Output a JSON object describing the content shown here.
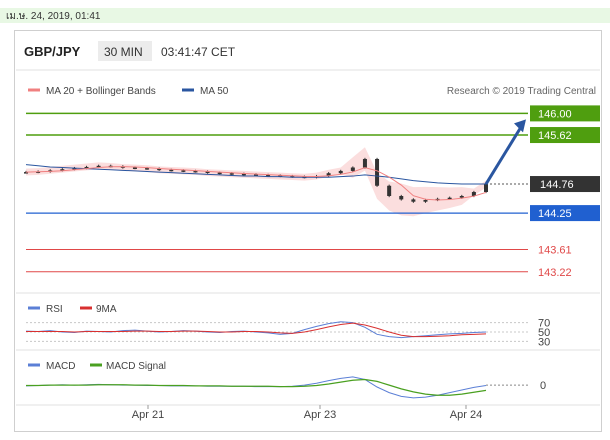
{
  "timestamp": "เม.ษ. 24, 2019, 01:41",
  "header": {
    "symbol": "GBP/JPY",
    "interval": "30 MIN",
    "time": "03:41:47 CET"
  },
  "legend": {
    "ma20": "MA 20 + Bollinger Bands",
    "ma50": "MA 50",
    "credit": "Research © 2019 Trading Central",
    "rsi": "RSI",
    "rsi_ma": "9MA",
    "macd": "MACD",
    "macd_signal": "MACD Signal"
  },
  "colors": {
    "ma20": "#f08080",
    "ma50": "#2a56a0",
    "resistance": "#4f9e0f",
    "support": "#2060d0",
    "support_red": "#e04848",
    "current": "#333333",
    "bollinger": "#fad6d6",
    "candle": "#333333",
    "rsi": "#5b7fd6",
    "rsi_ma": "#d83030",
    "macd": "#5b7fd6",
    "macd_signal": "#4aa020"
  },
  "chart_data": {
    "type": "line",
    "x_labels": [
      "Apr 21",
      "Apr 23",
      "Apr 24"
    ],
    "price_ylim": [
      142.9,
      146.2
    ],
    "price": [
      144.97,
      144.98,
      145.0,
      145.02,
      145.04,
      145.06,
      145.08,
      145.07,
      145.05,
      145.04,
      145.03,
      145.01,
      145.0,
      144.99,
      144.98,
      144.96,
      144.95,
      144.94,
      144.93,
      144.92,
      144.91,
      144.9,
      144.89,
      144.88,
      144.9,
      144.95,
      144.99,
      145.05,
      145.2,
      144.73,
      144.55,
      144.49,
      144.45,
      144.48,
      144.5,
      144.52,
      144.55,
      144.62,
      144.76
    ],
    "ma50": [
      145.1,
      145.08,
      145.06,
      145.05,
      145.04,
      145.03,
      145.02,
      145.01,
      145.0,
      144.99,
      144.98,
      144.97,
      144.96,
      144.95,
      144.94,
      144.93,
      144.92,
      144.91,
      144.9,
      144.9,
      144.89,
      144.89,
      144.88,
      144.88,
      144.88,
      144.88,
      144.89,
      144.9,
      144.92,
      144.9,
      144.88,
      144.85,
      144.82,
      144.8,
      144.78,
      144.77,
      144.76,
      144.76,
      144.76
    ],
    "levels": [
      {
        "value": 146.0,
        "label": "146.00",
        "kind": "resistance"
      },
      {
        "value": 145.62,
        "label": "145.62",
        "kind": "resistance"
      },
      {
        "value": 144.76,
        "label": "144.76",
        "kind": "current"
      },
      {
        "value": 144.25,
        "label": "144.25",
        "kind": "support"
      },
      {
        "value": 143.61,
        "label": "143.61",
        "kind": "support_red"
      },
      {
        "value": 143.22,
        "label": "143.22",
        "kind": "support_red"
      }
    ],
    "arrow": {
      "from_index": 38,
      "from": 144.76,
      "to": 146.0
    },
    "rsi_levels": [
      "70",
      "50",
      "30"
    ],
    "rsi_ylim": [
      20,
      80
    ],
    "rsi": [
      52,
      51,
      53,
      50,
      49,
      52,
      51,
      50,
      53,
      54,
      52,
      50,
      51,
      53,
      52,
      50,
      49,
      51,
      52,
      50,
      48,
      45,
      47,
      55,
      62,
      68,
      72,
      70,
      60,
      45,
      40,
      38,
      40,
      42,
      44,
      46,
      47,
      49,
      50
    ],
    "rsi_ma": [
      51,
      51,
      51,
      51,
      50,
      51,
      51,
      51,
      51,
      52,
      52,
      51,
      51,
      52,
      52,
      51,
      50,
      50,
      51,
      51,
      50,
      48,
      47,
      50,
      55,
      61,
      66,
      69,
      65,
      58,
      50,
      43,
      40,
      40,
      41,
      42,
      44,
      45,
      46
    ],
    "macd_zero_label": "0",
    "macd_ylim": [
      -0.45,
      0.35
    ],
    "macd": [
      -0.02,
      -0.01,
      0.0,
      0.01,
      0.0,
      0.01,
      0.02,
      0.01,
      0.0,
      0.0,
      -0.01,
      -0.01,
      -0.02,
      -0.02,
      -0.02,
      -0.03,
      -0.03,
      -0.03,
      -0.03,
      -0.04,
      -0.04,
      -0.04,
      -0.03,
      0.0,
      0.05,
      0.12,
      0.18,
      0.22,
      0.15,
      -0.05,
      -0.2,
      -0.3,
      -0.34,
      -0.32,
      -0.27,
      -0.2,
      -0.13,
      -0.06,
      -0.01
    ],
    "macd_signal": [
      -0.01,
      -0.01,
      0.0,
      0.0,
      0.0,
      0.0,
      0.01,
      0.01,
      0.01,
      0.0,
      0.0,
      -0.01,
      -0.01,
      -0.01,
      -0.02,
      -0.02,
      -0.02,
      -0.03,
      -0.03,
      -0.03,
      -0.03,
      -0.04,
      -0.04,
      -0.03,
      -0.01,
      0.03,
      0.08,
      0.13,
      0.15,
      0.1,
      0.0,
      -0.1,
      -0.18,
      -0.24,
      -0.27,
      -0.27,
      -0.24,
      -0.19,
      -0.14
    ]
  }
}
